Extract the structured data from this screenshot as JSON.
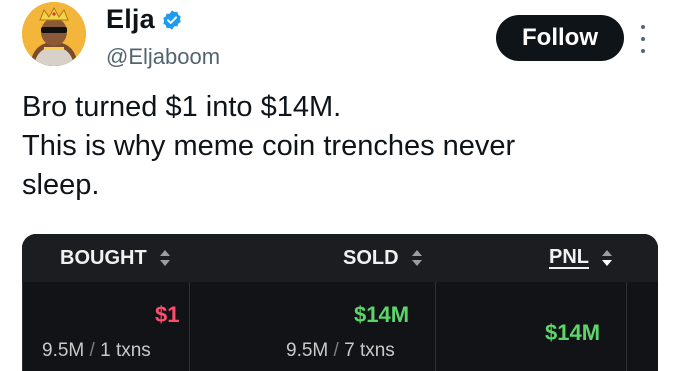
{
  "author": {
    "name": "Elja",
    "handle": "@Eljaboom",
    "verified": true,
    "avatar_icon": "avatar-king-icon"
  },
  "actions": {
    "follow_label": "Follow",
    "more_icon": "more-vertical-icon"
  },
  "tweet": {
    "lines": [
      "Bro turned $1 into $14M.",
      "This is why meme coin trenches never",
      "sleep."
    ]
  },
  "pnl_table": {
    "columns": [
      {
        "label": "BOUGHT",
        "sort_icon": "sort-up-down-icon"
      },
      {
        "label": "SOLD",
        "sort_icon": "sort-up-down-icon"
      },
      {
        "label": "PNL",
        "sort_icon": "sort-down-active-icon"
      }
    ],
    "row": {
      "bought": {
        "amount": "$1",
        "quantity": "9.5M",
        "sep": "/",
        "txns": "1 txns"
      },
      "sold": {
        "amount": "$14M",
        "quantity": "9.5M",
        "sep": "/",
        "txns": "7 txns"
      },
      "pnl": {
        "amount": "$14M"
      }
    },
    "colors": {
      "negative": "#ff4d6d",
      "positive": "#5cd66a",
      "background": "#121316",
      "header": "#1c1d21"
    }
  }
}
